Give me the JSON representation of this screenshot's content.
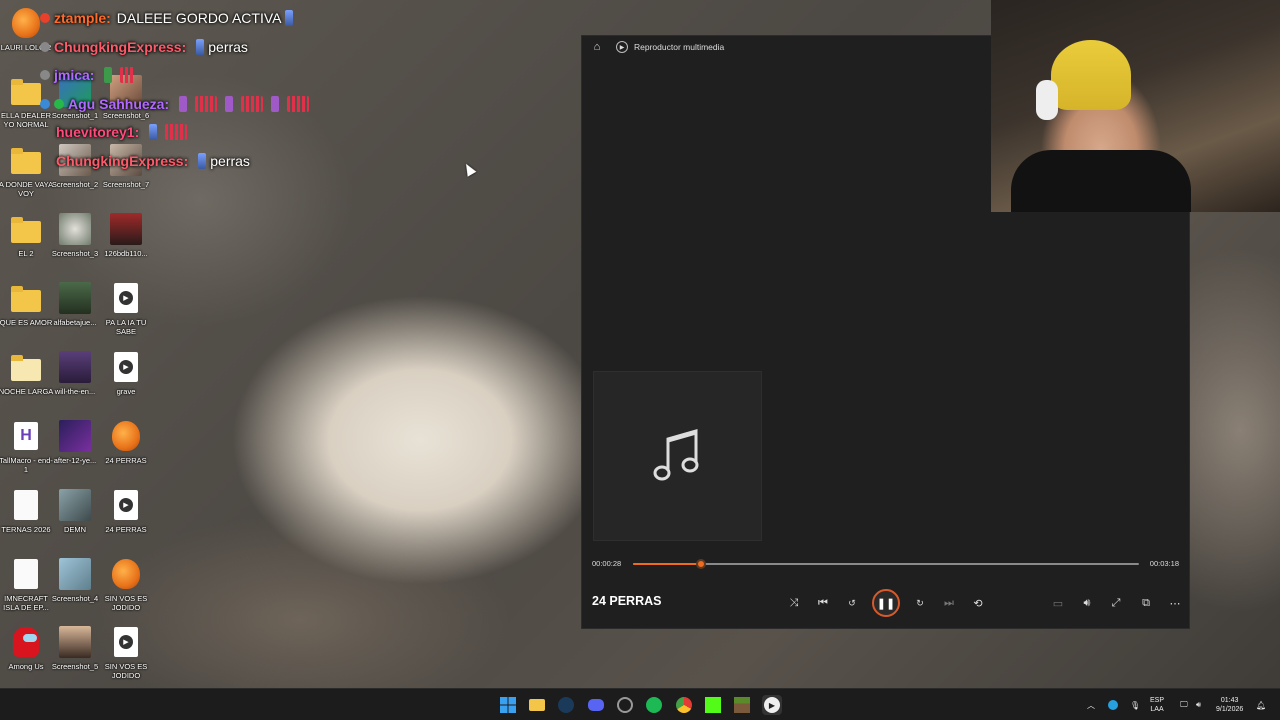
{
  "desktop": {
    "icons": [
      {
        "label": "LAURI LOLO 2",
        "kind": "fruit"
      },
      {
        "label": "ELLA DEALER YO NORMAL",
        "kind": "folder"
      },
      {
        "label": "A DONDE VAYA VOY",
        "kind": "folder"
      },
      {
        "label": "EL 2",
        "kind": "folder"
      },
      {
        "label": "QUE ES AMOR",
        "kind": "folder"
      },
      {
        "label": "NOCHE LARGA",
        "kind": "folder"
      },
      {
        "label": "TallMacro - end-1",
        "kind": "app-h"
      },
      {
        "label": "TERNAS 2026",
        "kind": "file"
      },
      {
        "label": "IMNECRAFT ISLA DE EP...",
        "kind": "file"
      },
      {
        "label": "Among Us",
        "kind": "among"
      },
      {
        "label": "Screenshot_1",
        "kind": "thumb"
      },
      {
        "label": "Screenshot_2",
        "kind": "thumb"
      },
      {
        "label": "Screenshot_3",
        "kind": "thumb"
      },
      {
        "label": "alfabetajue...",
        "kind": "thumb"
      },
      {
        "label": "will-the-en...",
        "kind": "thumb"
      },
      {
        "label": "after-12-ye...",
        "kind": "thumb"
      },
      {
        "label": "DEMN",
        "kind": "thumb"
      },
      {
        "label": "Screenshot_4",
        "kind": "thumb"
      },
      {
        "label": "Screenshot_5",
        "kind": "thumb"
      },
      {
        "label": "Screenshot_6",
        "kind": "thumb"
      },
      {
        "label": "Screenshot_7",
        "kind": "thumb"
      },
      {
        "label": "126bdb110...",
        "kind": "thumb"
      },
      {
        "label": "PA LA IA TU SABE",
        "kind": "media"
      },
      {
        "label": "grave",
        "kind": "media"
      },
      {
        "label": "24 PERRAS",
        "kind": "fruit"
      },
      {
        "label": "24 PERRAS",
        "kind": "media"
      },
      {
        "label": "SIN VOS ES JODIDO",
        "kind": "fruit"
      },
      {
        "label": "SIN VOS ES JODIDO",
        "kind": "media"
      }
    ]
  },
  "chat": [
    {
      "user": "ztample:",
      "color": "#ff6a2a",
      "message": "DALEEE GORDO ACTIVA"
    },
    {
      "user": "ChungkingExpress:",
      "color": "#ff5a6a",
      "message": "perras"
    },
    {
      "user": "jmica:",
      "color": "#b06aff",
      "message": ""
    },
    {
      "user": "Agu Sahhueza:",
      "color": "#b06aff",
      "message": ""
    },
    {
      "user": "huevitorey1:",
      "color": "#ff4a7a",
      "message": ""
    },
    {
      "user": "ChungkingExpress:",
      "color": "#ff5a6a",
      "message": "perras"
    }
  ],
  "player": {
    "app_title": "Reproductor multimedia",
    "song_title": "24 PERRAS",
    "elapsed": "00:00:28",
    "duration": "00:03:18",
    "progress": 0.135,
    "accent": "#ef6b1f",
    "controls": {
      "shuffle": "shuffle-icon",
      "previous": "previous-icon",
      "rewind": "rewind-10-icon",
      "pause": "pause-icon",
      "forward": "forward-30-icon",
      "next": "next-icon",
      "repeat": "repeat-icon",
      "miniplayer": "miniplayer-icon",
      "volume": "volume-icon",
      "fullscreen": "fullscreen-icon",
      "cast": "cast-icon",
      "more": "more-icon"
    }
  },
  "taskbar": {
    "language": "ESP",
    "region": "LAA",
    "time": "01:43",
    "date": "9/1/2026"
  }
}
